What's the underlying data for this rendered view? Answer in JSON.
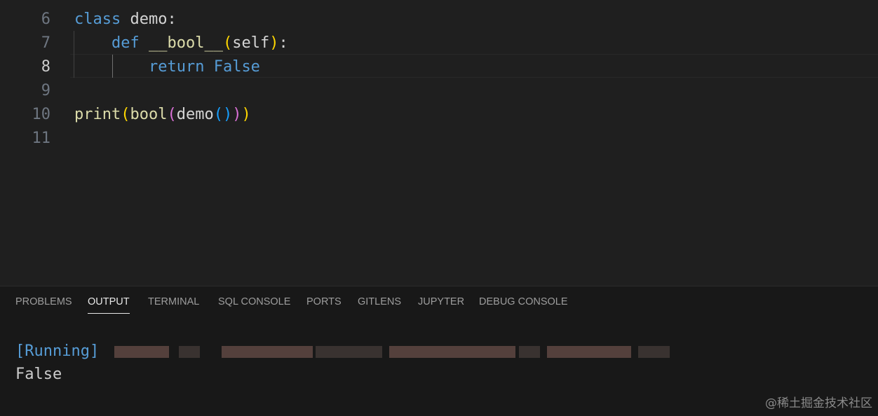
{
  "editor": {
    "lines": [
      {
        "number": "6",
        "segments": [
          {
            "t": "class",
            "c": "kw"
          },
          {
            "t": " demo:",
            "c": "plain"
          }
        ]
      },
      {
        "number": "7",
        "segments": [
          {
            "t": "    ",
            "c": "plain"
          },
          {
            "t": "def",
            "c": "kw"
          },
          {
            "t": " ",
            "c": "plain"
          },
          {
            "t": "__bool__",
            "c": "fn"
          },
          {
            "t": "(",
            "c": "br1"
          },
          {
            "t": "self",
            "c": "plain"
          },
          {
            "t": ")",
            "c": "br1"
          },
          {
            "t": ":",
            "c": "plain"
          }
        ]
      },
      {
        "number": "8",
        "segments": [
          {
            "t": "        ",
            "c": "plain"
          },
          {
            "t": "return",
            "c": "kw"
          },
          {
            "t": " ",
            "c": "plain"
          },
          {
            "t": "False",
            "c": "kw"
          }
        ]
      },
      {
        "number": "9",
        "segments": []
      },
      {
        "number": "10",
        "segments": [
          {
            "t": "print",
            "c": "fn"
          },
          {
            "t": "(",
            "c": "br1"
          },
          {
            "t": "bool",
            "c": "fn"
          },
          {
            "t": "(",
            "c": "br2"
          },
          {
            "t": "demo",
            "c": "plain"
          },
          {
            "t": "(",
            "c": "br3"
          },
          {
            "t": ")",
            "c": "br3"
          },
          {
            "t": ")",
            "c": "br2"
          },
          {
            "t": ")",
            "c": "br1"
          }
        ]
      },
      {
        "number": "11",
        "segments": []
      }
    ],
    "active_line": "8"
  },
  "panel": {
    "tabs": [
      "PROBLEMS",
      "OUTPUT",
      "TERMINAL",
      "SQL CONSOLE",
      "PORTS",
      "GITLENS",
      "JUPYTER",
      "DEBUG CONSOLE"
    ],
    "active_tab": "OUTPUT",
    "output": {
      "running_label": "[Running]",
      "result": "False"
    }
  },
  "watermark": "@稀土掘金技术社区",
  "colors": {
    "keyword": "#569cd6",
    "function": "#dcdcaa",
    "bracket_1": "#ffd700",
    "bracket_2": "#da70d6",
    "bracket_3": "#179fff"
  }
}
